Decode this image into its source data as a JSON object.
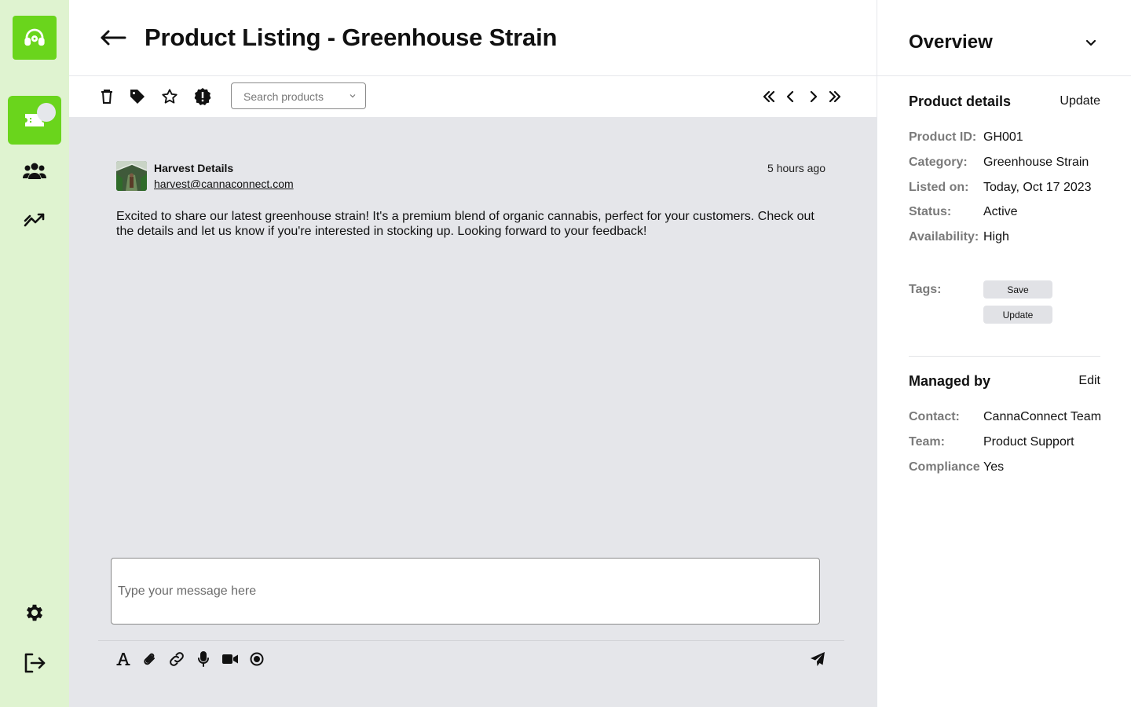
{
  "nav": {
    "logo_icon": "headset-icon",
    "items": [
      "ticket-icon",
      "users-icon",
      "trend-icon"
    ],
    "bottom": [
      "gear-icon",
      "logout-icon"
    ]
  },
  "header": {
    "title": "Product Listing - Greenhouse Strain"
  },
  "toolbar": {
    "search_placeholder": "Search products",
    "actions": [
      "trash-icon",
      "tag-icon",
      "star-icon",
      "alert-badge-icon"
    ],
    "pager": [
      "first-page-icon",
      "prev-page-icon",
      "next-page-icon",
      "last-page-icon"
    ]
  },
  "message": {
    "sender_name": "Harvest Details",
    "sender_email": "harvest@cannaconnect.com",
    "time": "5 hours ago",
    "body": "Excited to share our latest greenhouse strain! It's a premium blend of organic cannabis, perfect for your customers. Check out the details and let us know if you're interested in stocking up. Looking forward to your feedback!"
  },
  "composer": {
    "placeholder": "Type your message here",
    "tools": [
      "text-format-icon",
      "paperclip-icon",
      "link-icon",
      "microphone-icon",
      "video-icon",
      "record-icon"
    ],
    "send_icon": "send-icon"
  },
  "overview": {
    "title": "Overview",
    "product_details": {
      "title": "Product details",
      "action": "Update",
      "fields": [
        {
          "label": "Product ID:",
          "value": "GH001"
        },
        {
          "label": "Category:",
          "value": "Greenhouse Strain"
        },
        {
          "label": "Listed on:",
          "value": "Today, Oct 17 2023"
        },
        {
          "label": "Status:",
          "value": "Active"
        },
        {
          "label": "Availability:",
          "value": "High"
        }
      ],
      "tags_label": "Tags:",
      "tags": [
        "Save",
        "Update"
      ]
    },
    "managed_by": {
      "title": "Managed by",
      "action": "Edit",
      "fields": [
        {
          "label": "Contact:",
          "value": "CannaConnect Team"
        },
        {
          "label": "Team:",
          "value": "Product Support"
        },
        {
          "label": "Compliance",
          "value": "Yes"
        }
      ]
    }
  },
  "colors": {
    "accent": "#6ad51c",
    "nav_bg": "#dff3d0",
    "content_bg": "#e5e6ea"
  }
}
